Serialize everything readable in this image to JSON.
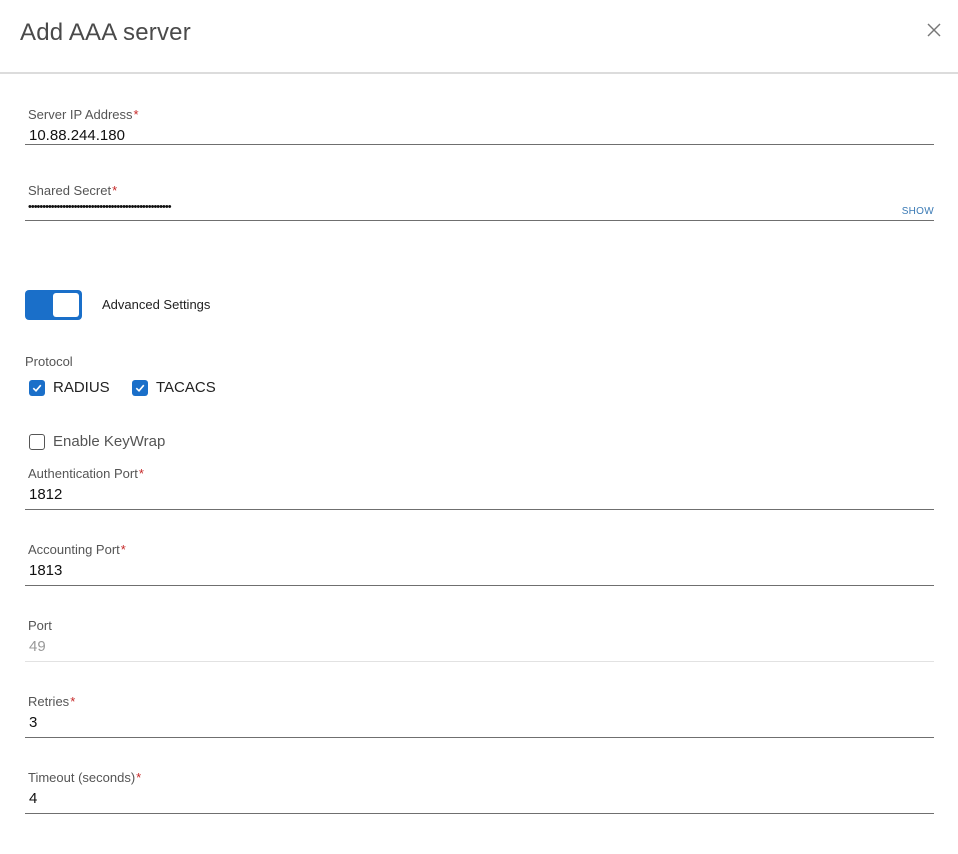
{
  "dialog": {
    "title": "Add AAA server",
    "close_icon": "close-icon"
  },
  "fields": {
    "server_ip": {
      "label": "Server IP Address",
      "required": "*",
      "value": "10.88.244.180"
    },
    "shared_secret": {
      "label": "Shared Secret",
      "required": "*",
      "value": "••••••••••••••••••••••••••••••••••••••••••••••••••",
      "show_label": "SHOW"
    },
    "auth_port": {
      "label": "Authentication Port",
      "required": "*",
      "value": "1812"
    },
    "acct_port": {
      "label": "Accounting Port",
      "required": "*",
      "value": "1813"
    },
    "port": {
      "label": "Port",
      "value": "49"
    },
    "retries": {
      "label": "Retries",
      "required": "*",
      "value": "3"
    },
    "timeout": {
      "label": "Timeout (seconds)",
      "required": "*",
      "value": "4"
    }
  },
  "advanced": {
    "label": "Advanced Settings",
    "enabled": true
  },
  "protocol": {
    "label": "Protocol",
    "options": [
      {
        "label": "RADIUS",
        "checked": true
      },
      {
        "label": "TACACS",
        "checked": true
      }
    ]
  },
  "keywrap": {
    "label": "Enable KeyWrap",
    "checked": false
  },
  "colors": {
    "accent": "#1a6fc9",
    "required": "#c62828",
    "link": "#3a7ab5"
  }
}
